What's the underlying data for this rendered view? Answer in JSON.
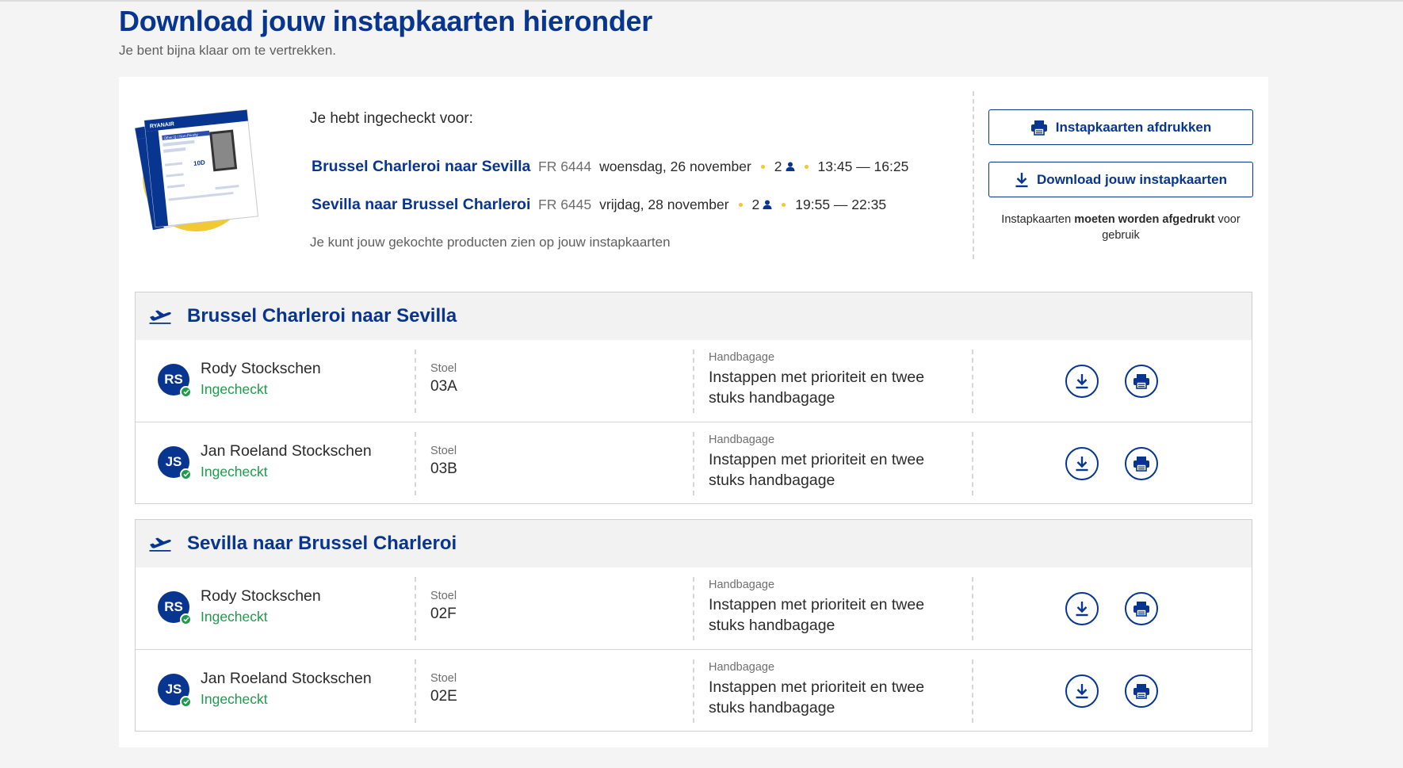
{
  "page": {
    "title": "Download jouw instapkaarten hieronder",
    "subtitle": "Je bent bijna klaar om te vertrekken."
  },
  "summary": {
    "checked_in_label": "Je hebt ingecheckt voor:",
    "flights": [
      {
        "route": "Brussel Charleroi naar Sevilla",
        "flight_number": "FR 6444",
        "date": "woensdag, 26 november",
        "passengers": "2",
        "time": "13:45 — 16:25"
      },
      {
        "route": "Sevilla naar Brussel Charleroi",
        "flight_number": "FR 6445",
        "date": "vrijdag, 28 november",
        "passengers": "2",
        "time": "19:55 — 22:35"
      }
    ],
    "products_note": "Je kunt jouw gekochte producten zien op jouw instapkaarten",
    "ticket_illustration": {
      "brand": "RYANAIR",
      "seat": "10D",
      "priority": "Other Q / Non-Priority"
    }
  },
  "actions": {
    "print_all_label": "Instapkaarten afdrukken",
    "download_all_label": "Download jouw instapkaarten",
    "note_before": "Instapkaarten ",
    "note_bold": "moeten worden afgedrukt",
    "note_after": " voor gebruik"
  },
  "sections": [
    {
      "title": "Brussel Charleroi naar Sevilla",
      "icon": "plane-departure-icon",
      "passengers": [
        {
          "initials": "RS",
          "name": "Rody Stockschen",
          "status": "Ingecheckt",
          "seat_label": "Stoel",
          "seat": "03A",
          "bag_label": "Handbagage",
          "bag": "Instappen met prioriteit en twee stuks handbagage"
        },
        {
          "initials": "JS",
          "name": "Jan Roeland Stockschen",
          "status": "Ingecheckt",
          "seat_label": "Stoel",
          "seat": "03B",
          "bag_label": "Handbagage",
          "bag": "Instappen met prioriteit en twee stuks handbagage"
        }
      ]
    },
    {
      "title": "Sevilla naar Brussel Charleroi",
      "icon": "plane-departure-icon",
      "passengers": [
        {
          "initials": "RS",
          "name": "Rody Stockschen",
          "status": "Ingecheckt",
          "seat_label": "Stoel",
          "seat": "02F",
          "bag_label": "Handbagage",
          "bag": "Instappen met prioriteit en twee stuks handbagage"
        },
        {
          "initials": "JS",
          "name": "Jan Roeland Stockschen",
          "status": "Ingecheckt",
          "seat_label": "Stoel",
          "seat": "02E",
          "bag_label": "Handbagage",
          "bag": "Instappen met prioriteit en twee stuks handbagage"
        }
      ]
    }
  ],
  "colors": {
    "brand_blue": "#073590",
    "accent_yellow": "#f1c933",
    "checked_in_green": "#1f9a4b"
  }
}
